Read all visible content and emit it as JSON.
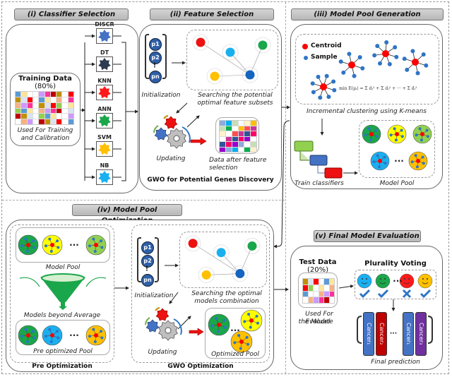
{
  "phases": {
    "classifier_selection": {
      "title": "(i) Classifier Selection",
      "training_data_title": "Training Data",
      "training_data_pct": "(80%)",
      "training_data_caption_1": "Used For Training",
      "training_data_caption_2": "and Calibration",
      "classifiers": [
        {
          "name": "DISCR",
          "color": "#4472c4"
        },
        {
          "name": "DT",
          "color": "#2e3a50"
        },
        {
          "name": "KNN",
          "color": "#ff1a1a"
        },
        {
          "name": "ANN",
          "color": "#1aa64a"
        },
        {
          "name": "SVM",
          "color": "#ffc000"
        },
        {
          "name": "NB",
          "color": "#1ab0f0"
        }
      ]
    },
    "feature_selection": {
      "title": "(ii) Feature Selection",
      "particles": [
        "p1",
        "p2",
        "pn"
      ],
      "init_label": "Initialization",
      "search_label_1": "Searching the potential",
      "search_label_2": "optimal feature subsets",
      "updating_label": "Updating",
      "data_after_1": "Data after feature",
      "data_after_2": "selection",
      "footer": "GWO for Potential Genes Discovery"
    },
    "model_pool_generation": {
      "title": "(iii) Model Pool  Generation",
      "legend_centroid": "Centroid",
      "legend_sample": "Sample",
      "formula": "min E(μᵢ) = Σ dⱼ² + Σ dⱼ² + ··· + Σ dⱼ²",
      "clustering_label": "Incremental clustering using K-means",
      "train_label": "Train classifiers",
      "pool_label": "Model Pool",
      "pool_colors": [
        "#1aa64a",
        "#ffff00",
        "#92d050",
        "#1ab0f0",
        "#ffc000"
      ]
    },
    "model_pool_optimization": {
      "title": "(iv) Model Pool  Optimization",
      "pre": {
        "model_pool_label": "Model Pool",
        "filter_label": "Models beyond Average",
        "pre_pool_label": "Pre optimized Pool",
        "footer": "Pre Optimization",
        "pool_colors": [
          "#1aa64a",
          "#ffff00",
          "#92d050"
        ],
        "pre_pool_colors": [
          "#1aa64a",
          "#1ab0f0",
          "#ffc000"
        ]
      },
      "gwo": {
        "particles": [
          "p1",
          "p2",
          "pn"
        ],
        "init_label": "Initialization",
        "search_label_1": "Searching the optimal",
        "search_label_2": "models combination",
        "updating_label": "Updating",
        "optimized_label": "Optimized Pool",
        "footer": "GWO Optimization",
        "optimized_colors": [
          "#1aa64a",
          "#ffff00",
          "#ffc000"
        ]
      }
    },
    "final_evaluation": {
      "title": "(v) Final Model Evaluation",
      "test_data_title": "Test Data",
      "test_data_pct": "(20%)",
      "test_caption_1": "Used For Evaluate",
      "test_caption_2": "the Model",
      "voting_title": "Plurality Voting",
      "voters": [
        {
          "color": "#1ab0f0",
          "vote": "check"
        },
        {
          "color": "#1aa64a",
          "vote": "check"
        },
        {
          "color": "#ff1a1a",
          "vote": "cross"
        },
        {
          "color": "#ffc000",
          "vote": "check"
        }
      ],
      "cancers": [
        {
          "label": "Cancer₁",
          "color": "#4472c4"
        },
        {
          "label": "Cancer₂",
          "color": "#c00000"
        },
        {
          "label": "Cancer₁",
          "color": "#4472c4"
        },
        {
          "label": "Cancer₃",
          "color": "#7030a0"
        }
      ],
      "final_label": "Final prediction"
    }
  },
  "ellipsis": "···",
  "vdots": "⋮"
}
